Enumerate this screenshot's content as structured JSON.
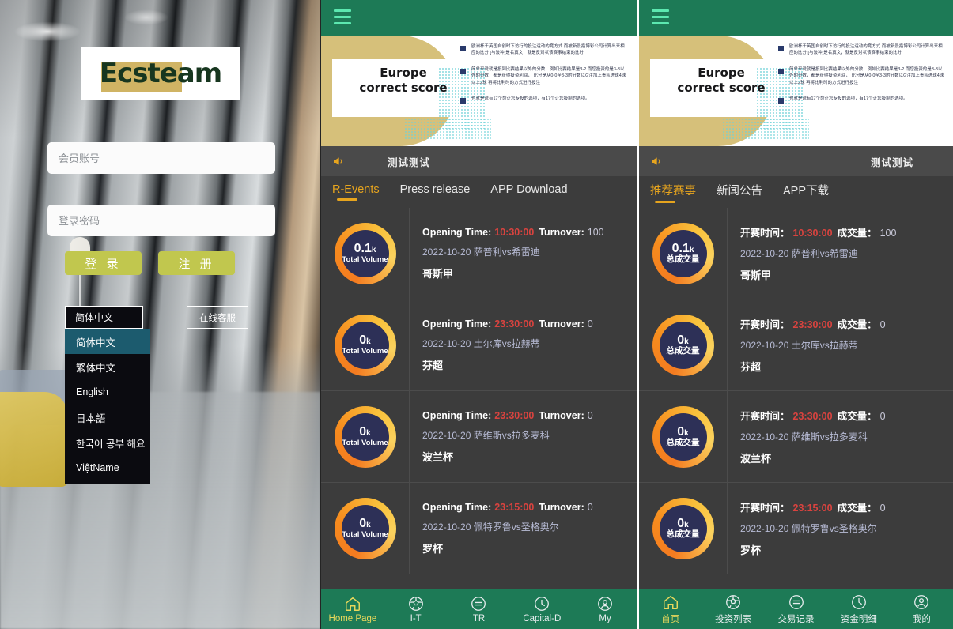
{
  "login": {
    "logo_text": "Ecsteam",
    "account_placeholder": "会员账号",
    "password_placeholder": "登录密码",
    "login_button": "登 录",
    "register_button": "注 册",
    "language_selected": "简体中文",
    "language_options": [
      "简体中文",
      "繁体中文",
      "English",
      "日本語",
      "한국어 공부 해요",
      "ViệtName"
    ],
    "customer_service": "在线客服",
    "accent_button_color": "#c1c74e",
    "logo_green": "#17361f",
    "logo_gold": "#d0b464"
  },
  "banner": {
    "title_line1": "Europe",
    "title_line2": "correct score",
    "bullets": [
      "欧洲杯于英国自创时下访行的投注运动的竞方式\n而被新景指博彩公司计算出来相应的比分\n[与波种]是名真文，就是反对状该赛事结束的比分",
      "简单来说就是投到比赛结果以外的分数，例如比赛结果是3-2\n而您投资的是3-3以外的分数，都是获得投资利润，\n比分是从0-0至3-3的分数以G注加上贵队进球4球以上2球\n再将比利时的方式进行投注",
      "也就是说有17个命让您专投的选项，有17个让您投制的选项。"
    ],
    "gold_color": "#d6c07a",
    "dot_color": "#6fd1d8"
  },
  "mid": {
    "marquee": "测试测试",
    "tabs": [
      {
        "label": "R-Events",
        "active": true
      },
      {
        "label": "Press release",
        "active": false
      },
      {
        "label": "APP Download",
        "active": false
      }
    ],
    "labels": {
      "opening_time": "Opening Time:",
      "turnover": "Turnover:",
      "total_volume": "Total Volume"
    },
    "events": [
      {
        "volume": "0.1",
        "unit": "k",
        "time": "10:30:00",
        "turnover": "100",
        "date": "2022-10-20",
        "match": "萨普利vs希雷迪",
        "league": "哥斯甲"
      },
      {
        "volume": "0",
        "unit": "k",
        "time": "23:30:00",
        "turnover": "0",
        "date": "2022-10-20",
        "match": "土尔库vs拉赫蒂",
        "league": "芬超"
      },
      {
        "volume": "0",
        "unit": "k",
        "time": "23:30:00",
        "turnover": "0",
        "date": "2022-10-20",
        "match": "萨维斯vs拉多麦科",
        "league": "波兰杯"
      },
      {
        "volume": "0",
        "unit": "k",
        "time": "23:15:00",
        "turnover": "0",
        "date": "2022-10-20",
        "match": "佩特罗鲁vs圣格奥尔",
        "league": "罗杯"
      }
    ],
    "nav": [
      {
        "label": "Home Page",
        "icon": "home-icon",
        "active": true
      },
      {
        "label": "I-T",
        "icon": "soccer-ball-icon",
        "active": false
      },
      {
        "label": "TR",
        "icon": "transaction-icon",
        "active": false
      },
      {
        "label": "Capital-D",
        "icon": "clock-icon",
        "active": false
      },
      {
        "label": "My",
        "icon": "person-icon",
        "active": false
      }
    ]
  },
  "right": {
    "marquee": "测试测试",
    "tabs": [
      {
        "label": "推荐赛事",
        "active": true
      },
      {
        "label": "新闻公告",
        "active": false
      },
      {
        "label": "APP下载",
        "active": false
      }
    ],
    "labels": {
      "opening_time": "开赛时间：",
      "turnover": "成交量：",
      "total_volume": "总成交量"
    },
    "events": [
      {
        "volume": "0.1",
        "unit": "k",
        "time": "10:30:00",
        "turnover": "100",
        "date": "2022-10-20",
        "match": "萨普利vs希雷迪",
        "league": "哥斯甲"
      },
      {
        "volume": "0",
        "unit": "k",
        "time": "23:30:00",
        "turnover": "0",
        "date": "2022-10-20",
        "match": "土尔库vs拉赫蒂",
        "league": "芬超"
      },
      {
        "volume": "0",
        "unit": "k",
        "time": "23:30:00",
        "turnover": "0",
        "date": "2022-10-20",
        "match": "萨维斯vs拉多麦科",
        "league": "波兰杯"
      },
      {
        "volume": "0",
        "unit": "k",
        "time": "23:15:00",
        "turnover": "0",
        "date": "2022-10-20",
        "match": "佩特罗鲁vs圣格奥尔",
        "league": "罗杯"
      }
    ],
    "nav": [
      {
        "label": "首页",
        "icon": "home-icon",
        "active": true
      },
      {
        "label": "投资列表",
        "icon": "soccer-ball-icon",
        "active": false
      },
      {
        "label": "交易记录",
        "icon": "transaction-icon",
        "active": false
      },
      {
        "label": "资金明细",
        "icon": "clock-icon",
        "active": false
      },
      {
        "label": "我的",
        "icon": "person-icon",
        "active": false
      }
    ]
  },
  "theme": {
    "header_green": "#1d7a56",
    "accent_yellow": "#e6a41e",
    "time_red": "#d9433f",
    "panel_bg": "#3c3c3c"
  }
}
